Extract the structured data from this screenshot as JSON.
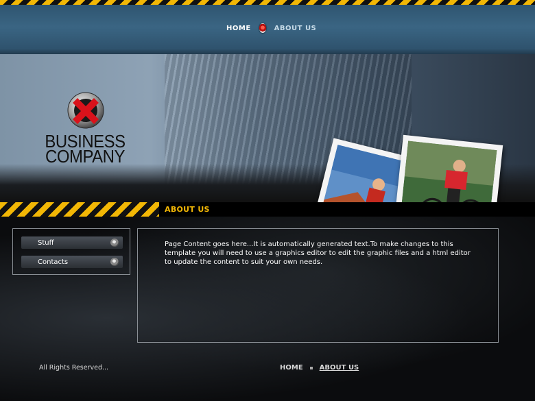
{
  "nav": {
    "home": "HOME",
    "about": "ABOUT US"
  },
  "brand": {
    "line1": "BUSINESS",
    "line2": "COMPANY",
    "logo_icon": "x-circle-icon"
  },
  "section": {
    "title": "ABOUT US"
  },
  "sidebar": {
    "items": [
      {
        "label": "Stuff"
      },
      {
        "label": "Contacts"
      }
    ]
  },
  "content": {
    "text": "Page Content goes here...It is automatically generated text.To make changes to this template you will need to use a graphics editor to edit the graphic files and a html editor to update the content to suit your own needs."
  },
  "footer": {
    "copyright": "All Rights Reserved...",
    "home": "HOME",
    "about": "ABOUT US"
  },
  "colors": {
    "accent": "#f2b705",
    "header_blue": "#3a6583",
    "logo_red": "#d9121b"
  }
}
